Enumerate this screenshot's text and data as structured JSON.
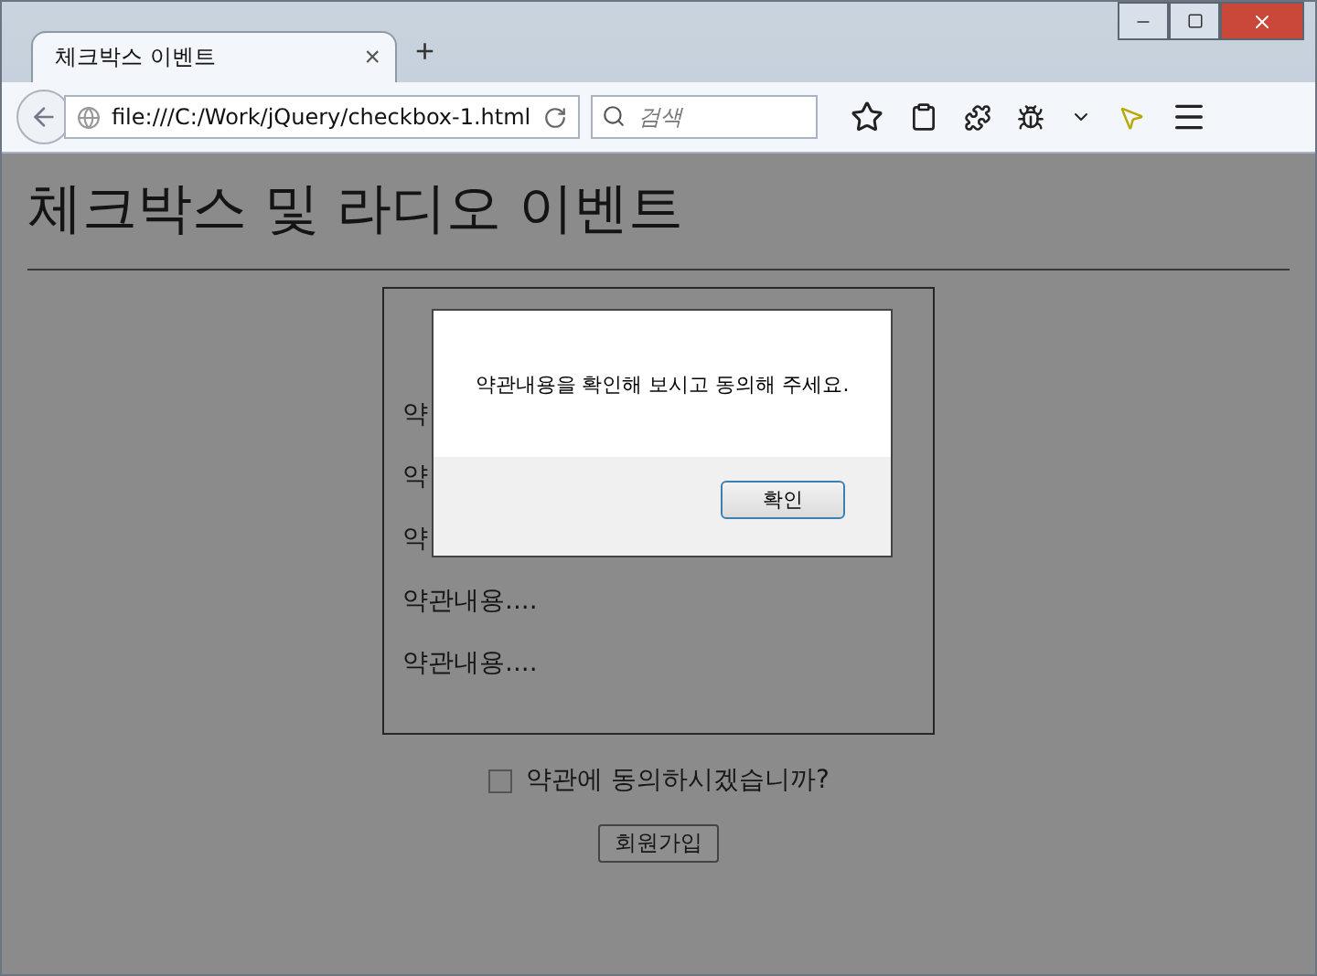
{
  "browser": {
    "tab": {
      "title": "체크박스 이벤트",
      "close": "×",
      "selected": true
    },
    "new_tab": "+",
    "address": "file:///C:/Work/jQuery/checkbox-1.html",
    "search": {
      "placeholder": "검색"
    }
  },
  "page": {
    "heading": "체크박스 및 라디오 이벤트",
    "terms": [
      "약",
      "약",
      "약",
      "약관내용....",
      "약관내용...."
    ],
    "agree": {
      "label": "약관에 동의하시겠습니까?",
      "checked": false
    },
    "submit": "회원가입"
  },
  "dialog": {
    "message": "약관내용을 확인해 보시고 동의해 주세요.",
    "button": "확인"
  }
}
